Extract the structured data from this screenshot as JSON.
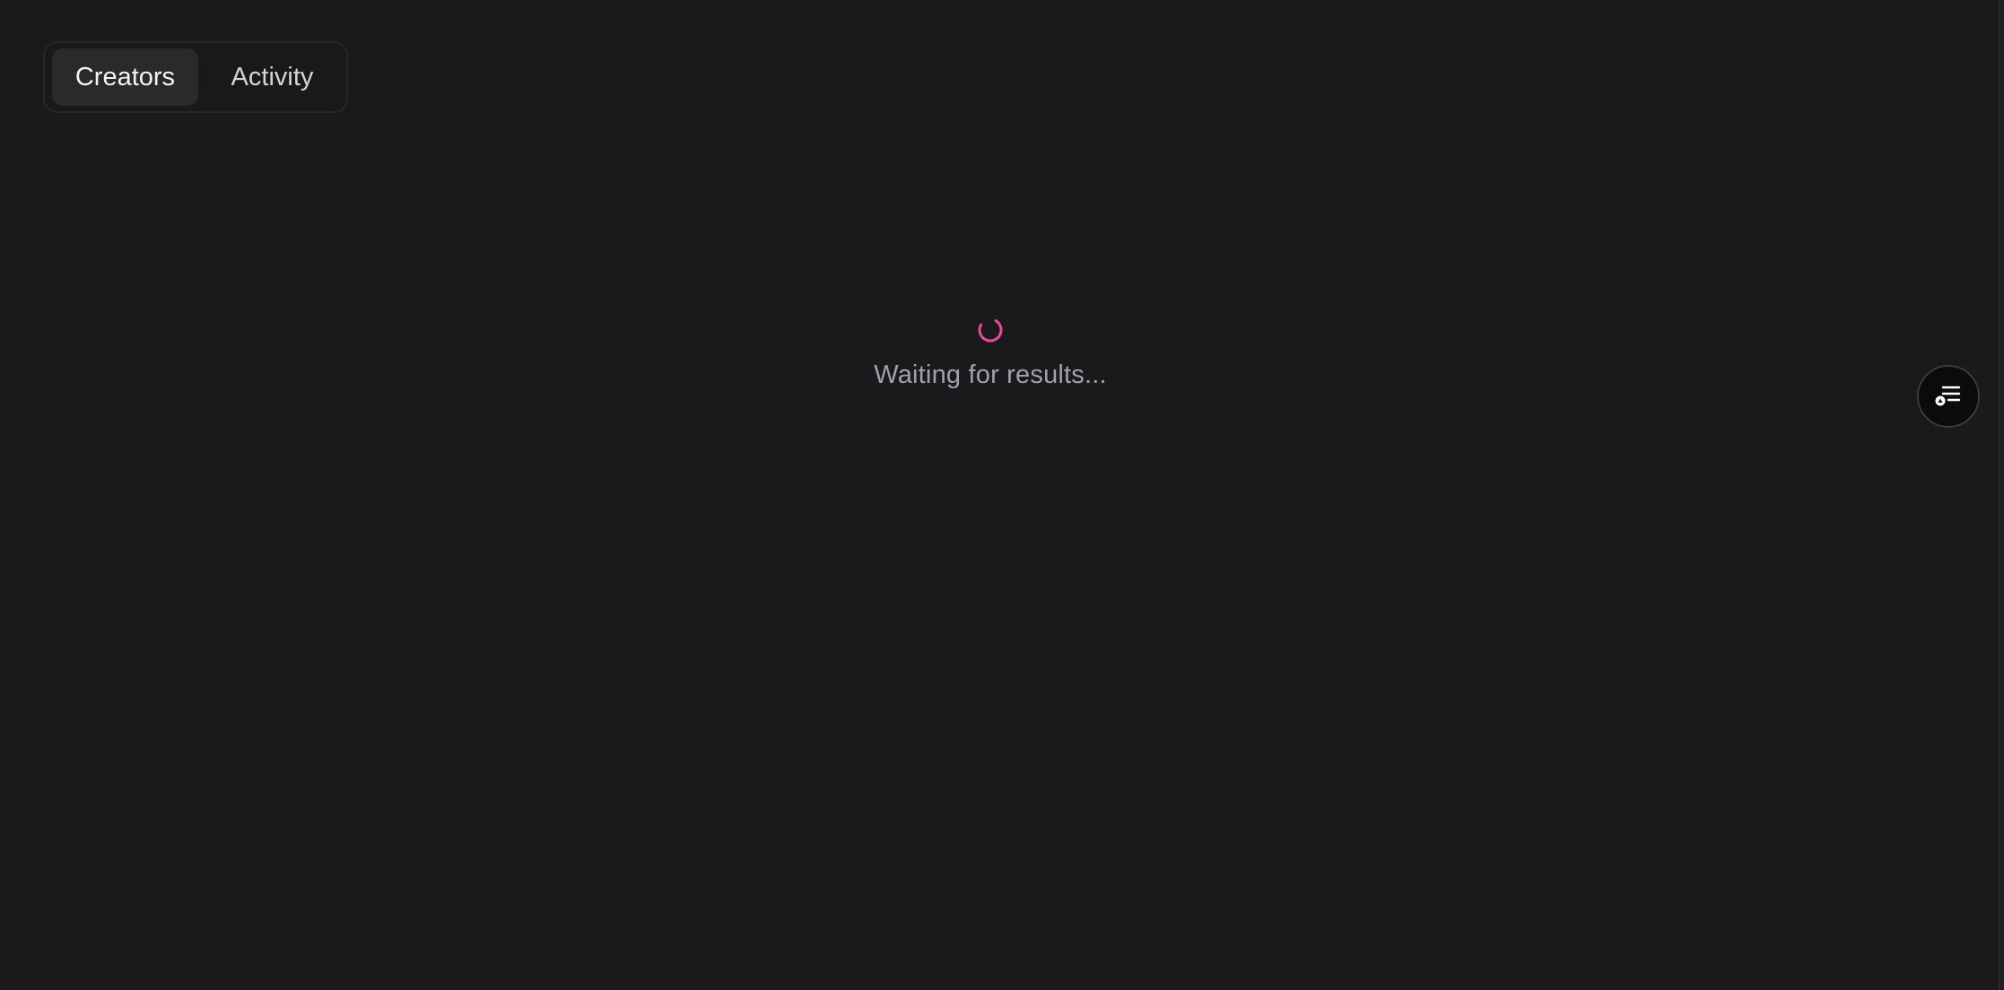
{
  "tabs": {
    "items": [
      {
        "label": "Creators",
        "active": true
      },
      {
        "label": "Activity",
        "active": false
      }
    ]
  },
  "main": {
    "loading_text": "Waiting for results..."
  },
  "floating_button": {
    "icon": "list-filter-icon"
  },
  "colors": {
    "background": "#1a1a1c",
    "spinner_accent": "#ec4899",
    "muted_text": "#a1a1aa"
  }
}
